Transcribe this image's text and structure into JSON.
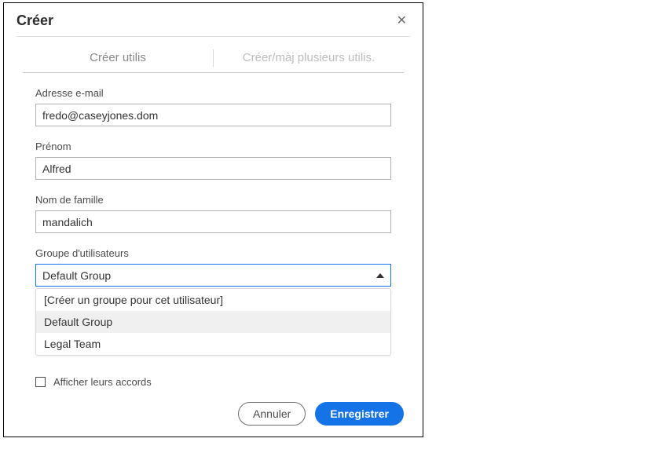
{
  "dialog": {
    "title": "Créer"
  },
  "tabs": {
    "create_one": "Créer utilis",
    "create_many": "Créer/màj plusieurs utilis."
  },
  "fields": {
    "email": {
      "label": "Adresse e-mail",
      "value": "fredo@caseyjones.dom"
    },
    "first_name": {
      "label": "Prénom",
      "value": "Alfred"
    },
    "last_name": {
      "label": "Nom de famille",
      "value": "mandalich"
    },
    "group": {
      "label": "Groupe d'utilisateurs",
      "selected": "Default Group"
    }
  },
  "dropdown": {
    "options": [
      {
        "label": "[Créer un groupe pour cet utilisateur]",
        "highlighted": false
      },
      {
        "label": "Default Group",
        "highlighted": true
      },
      {
        "label": "Legal Team",
        "highlighted": false
      }
    ]
  },
  "checkbox": {
    "label": "Afficher leurs accords",
    "checked": false
  },
  "buttons": {
    "cancel": "Annuler",
    "save": "Enregistrer"
  }
}
